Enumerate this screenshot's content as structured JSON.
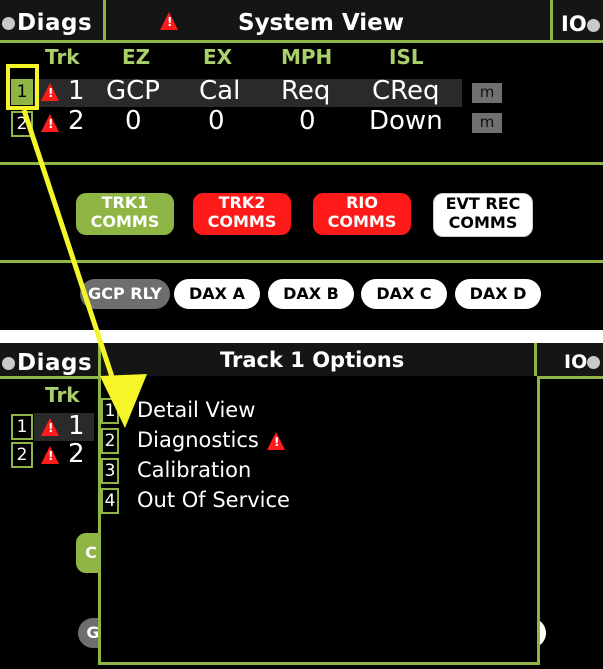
{
  "top": {
    "header": {
      "left": "Diags",
      "title": "System View",
      "right": "IO"
    },
    "columns": [
      "Trk",
      "EZ",
      "EX",
      "MPH",
      "ISL"
    ],
    "rows": [
      {
        "trk": "1",
        "ez": "GCP",
        "ex": "Cal",
        "mph": "Req",
        "isl": "CReq",
        "m": "m",
        "num": "1"
      },
      {
        "trk": "2",
        "ez": "0",
        "ex": "0",
        "mph": "0",
        "isl": "Down",
        "m": "m",
        "num": "2"
      }
    ],
    "comms": [
      {
        "line1": "TRK1",
        "line2": "COMMS"
      },
      {
        "line1": "TRK2",
        "line2": "COMMS"
      },
      {
        "line1": "RIO",
        "line2": "COMMS"
      },
      {
        "line1": "EVT REC",
        "line2": "COMMS"
      }
    ],
    "pills": [
      "GCP RLY",
      "DAX A",
      "DAX B",
      "DAX C",
      "DAX D"
    ]
  },
  "bottom": {
    "header": {
      "left": "Diags",
      "title": "Track 1 Options",
      "right": "IO"
    },
    "trk_label": "Trk",
    "rows": [
      {
        "num": "1",
        "trk": "1"
      },
      {
        "num": "2",
        "trk": "2"
      }
    ],
    "menu": [
      {
        "num": "1",
        "label": "Detail View"
      },
      {
        "num": "2",
        "label": "Diagnostics"
      },
      {
        "num": "3",
        "label": "Calibration"
      },
      {
        "num": "4",
        "label": "Out Of Service"
      }
    ],
    "peek_left": "C",
    "peek_bottom": "G"
  },
  "colors": {
    "accent": "#8fb545",
    "alert": "#ff1a1a",
    "highlight": "#f5f52a"
  }
}
